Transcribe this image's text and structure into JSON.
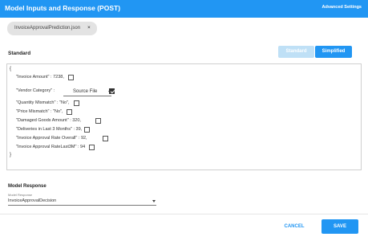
{
  "header": {
    "title": "Model Inputs and Response (POST)",
    "advanced_settings": "Advanced Settings"
  },
  "file_tab": {
    "label": "InvoiceApprovalPrediction.json",
    "close": "×"
  },
  "section": {
    "label": "Standard",
    "toggle_standard": "Standard",
    "toggle_simplified": "Simplified",
    "active_mode": "Simplified"
  },
  "editor": {
    "open_brace": "{",
    "close_brace": "}",
    "fields": [
      {
        "text": "\"Invoice Amount\" : 7238,",
        "checked": false
      },
      {
        "text": "\"Vendor Category\" :",
        "checked": true,
        "select_value": "Source File"
      },
      {
        "text": "\"Quantity Mismatch\" : \"No\",",
        "checked": false
      },
      {
        "text": "\"Price Mismatch\" : \"No\",",
        "checked": false
      },
      {
        "text": "\"Damaged Goods Amount\" : 320,",
        "checked": false
      },
      {
        "text": "\"Deliveries in Last 3 Months\" : 39,",
        "checked": false
      },
      {
        "text": "\"Invoice Approval Rate Overall\" : 92,",
        "checked": false
      },
      {
        "text": "\"Invoice Approval RateLast3M\" : 94",
        "checked": false
      }
    ]
  },
  "model_response": {
    "title": "Model Response",
    "small_label": "Model Response",
    "value": "InvoiceApprovalDecision"
  },
  "footer": {
    "cancel": "CANCEL",
    "save": "SAVE"
  },
  "colors": {
    "primary": "#2196f3",
    "primary_light": "#bfe0f6"
  }
}
